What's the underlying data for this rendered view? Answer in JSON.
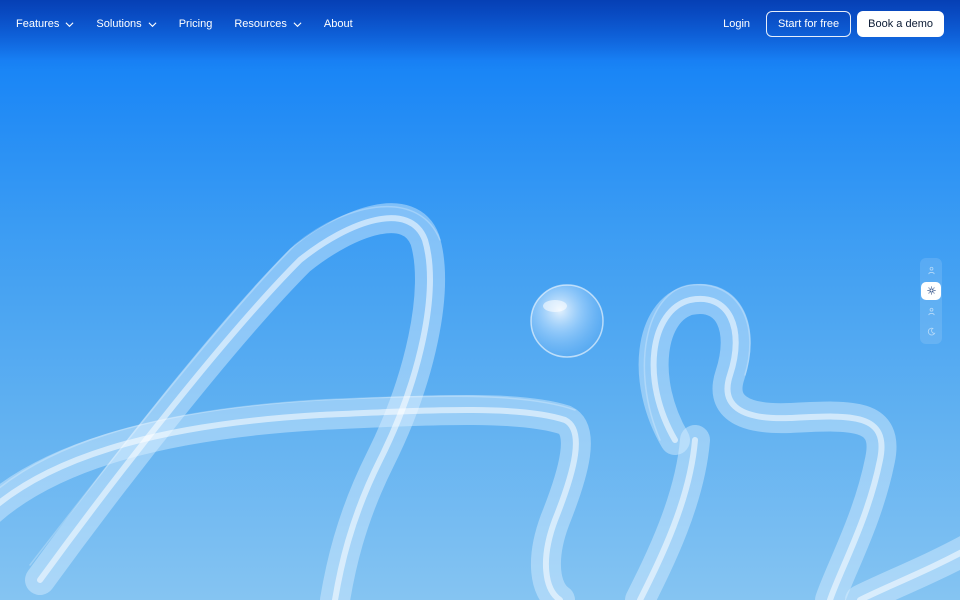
{
  "nav": {
    "items": [
      {
        "label": "Features",
        "has_dropdown": true
      },
      {
        "label": "Solutions",
        "has_dropdown": true
      },
      {
        "label": "Pricing",
        "has_dropdown": false
      },
      {
        "label": "Resources",
        "has_dropdown": true
      },
      {
        "label": "About",
        "has_dropdown": false
      }
    ],
    "login_label": "Login",
    "start_label": "Start for free",
    "demo_label": "Book a demo"
  },
  "side_rail": {
    "icons": [
      "person-icon",
      "sun-icon",
      "person-icon",
      "moon-icon"
    ],
    "active_index": 1
  },
  "colors": {
    "sky_top": "#0a5ce6",
    "sky_mid": "#3b9cf3",
    "sky_bottom": "#85c4f2",
    "button_text": "#0b1a33"
  }
}
